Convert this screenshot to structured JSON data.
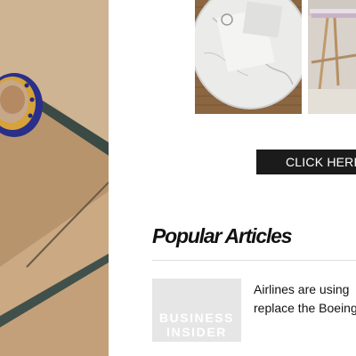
{
  "cta": {
    "label": "CLICK HERE"
  },
  "popular": {
    "title": "Popular Articles",
    "articles": [
      {
        "title_line1": "Airlines are using",
        "title_line2": "replace the Boeing",
        "thumb_logo_line1": "BUSINESS",
        "thumb_logo_line2": "INSIDER"
      }
    ]
  },
  "colors": {
    "cta_background": "#1b1b1b",
    "cta_text": "#ffffff",
    "placeholder_background": "#e6e6e6",
    "rule": "#dddddd"
  }
}
